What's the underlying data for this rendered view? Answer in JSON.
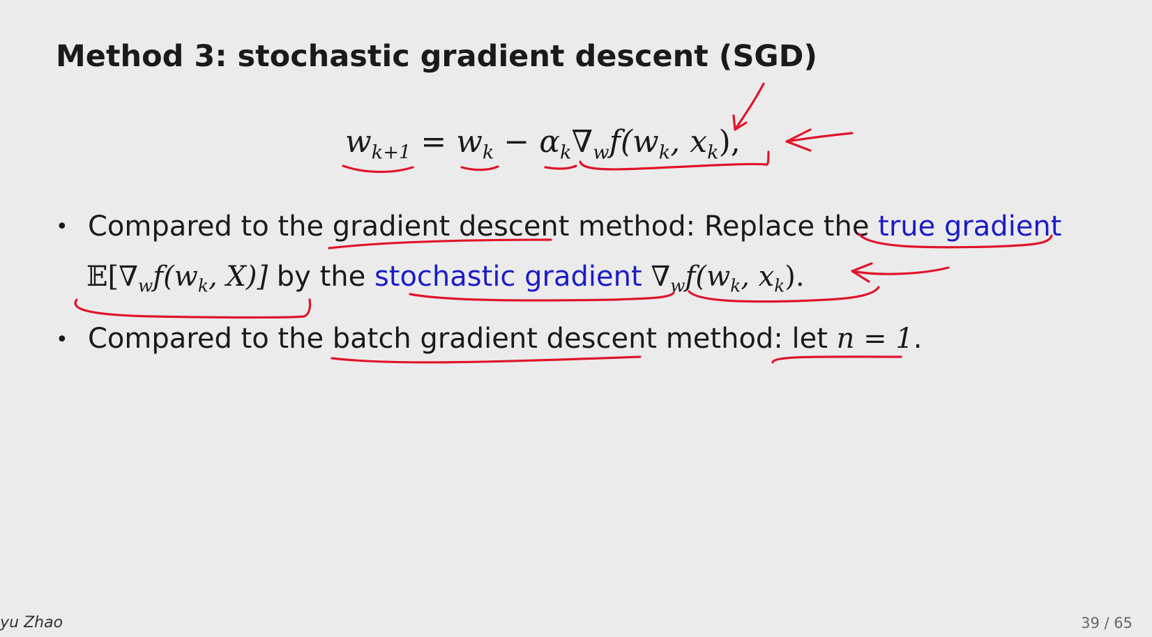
{
  "slide": {
    "title": "Method 3: stochastic gradient descent (SGD)",
    "equation": {
      "lhs": "w",
      "lhs_sub": "k+1",
      "eq": " = ",
      "w": "w",
      "w_sub": "k",
      "minus": " − ",
      "alpha": "α",
      "alpha_sub": "k",
      "nabla": "∇",
      "nabla_sub": "w",
      "f_open": "f(w",
      "f_sub1": "k",
      "comma": ", x",
      "f_sub2": "k",
      "close": "),"
    },
    "bullet1": {
      "part1": "Compared to the ",
      "underlined": "gradient descent",
      "part2": " method: Replace the ",
      "blue1": "true gradient",
      "expectation": "𝔼[∇",
      "exp_sub": "w",
      "exp_rest": "f(w",
      "exp_sub2": "k",
      "exp_end": ", X)]",
      "part3": " by the ",
      "blue2": "stochastic gradient",
      "sg_nabla": " ∇",
      "sg_sub": "w",
      "sg_f": "f(w",
      "sg_sub2": "k",
      "sg_x": ", x",
      "sg_sub3": "k",
      "sg_end": ")."
    },
    "bullet2": {
      "part1": "Compared to the ",
      "underlined": "batch gradient descent",
      "part2": " method: ",
      "let": "let ",
      "n_eq": "n = 1",
      "end": "."
    },
    "bullet_symbol": "•"
  },
  "footer": {
    "author": "iyu Zhao",
    "page": "39 / 65"
  },
  "colors": {
    "annotation": "#e0142a",
    "highlight_blue": "#1b1bc8",
    "background": "#ebebeb"
  }
}
